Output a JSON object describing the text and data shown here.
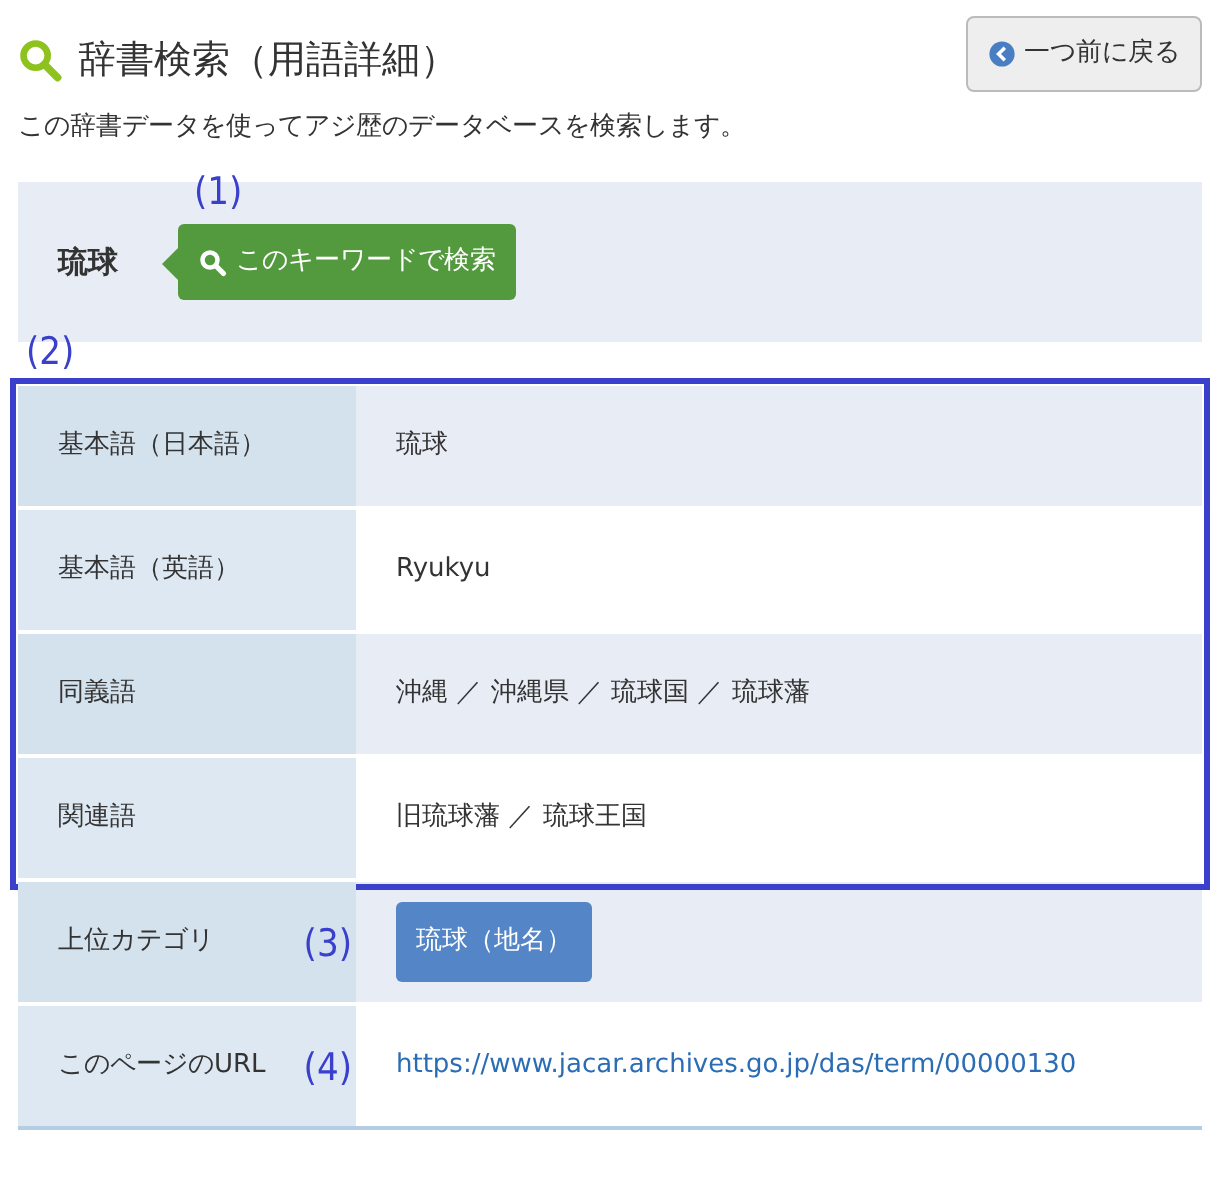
{
  "header": {
    "title": "辞書検索（用語詳細）",
    "back_button": "一つ前に戻る"
  },
  "description": "この辞書データを使ってアジ歴のデータベースを検索します。",
  "keyword": {
    "note": "(1)",
    "term": "琉球",
    "search_button": "このキーワードで検索"
  },
  "details": {
    "highlighted_group": {
      "note": "(2)",
      "rows": [
        {
          "label": "基本語（日本語）",
          "kind": "text",
          "value": "琉球"
        },
        {
          "label": "基本語（英語）",
          "kind": "text",
          "value": "Ryukyu"
        },
        {
          "label": "同義語",
          "kind": "text",
          "value": "沖縄 ／ 沖縄県 ／ 琉球国 ／ 琉球藩"
        },
        {
          "label": "関連語",
          "kind": "text",
          "value": "旧琉球藩 ／ 琉球王国"
        }
      ]
    },
    "other_rows": [
      {
        "label": "上位カテゴリ",
        "note": "(3)",
        "kind": "tag",
        "value": "琉球（地名）"
      },
      {
        "label": "このページのURL",
        "note": "(4)",
        "kind": "link",
        "value": "https://www.jacar.archives.go.jp/das/term/00000130"
      }
    ]
  }
}
